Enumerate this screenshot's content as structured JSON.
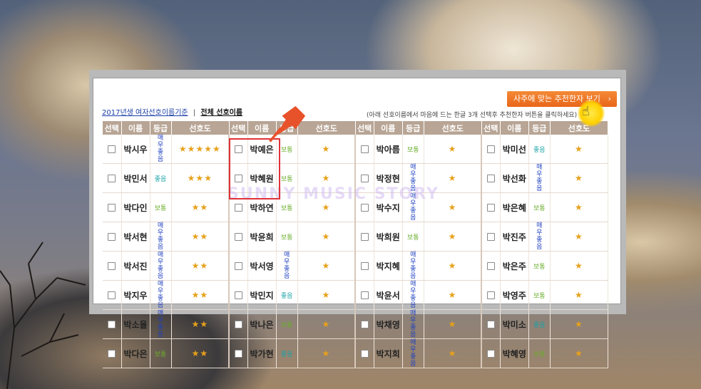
{
  "header": {
    "link_2017": "2017년생 여자선호이름기준",
    "separator": "|",
    "link_all": "전체 선호이름",
    "note": "(아래 선호이름에서 마음에 드는 한글 3개 선택후 추천한자 버튼을 클릭하세요)",
    "recommend_button": "사주에 맞는 추천한자 보기",
    "recommend_arrow": "›"
  },
  "watermark": "SUNNY MUSIC STORY",
  "table": {
    "headers": [
      "선택",
      "이름",
      "등급",
      "선호도"
    ],
    "columns": [
      {
        "rows": [
          {
            "name": "박시우",
            "grade": "매우좋음",
            "grade_type": "veryhigh",
            "stars": 5
          },
          {
            "name": "박민서",
            "grade": "좋음",
            "grade_type": "good",
            "stars": 3
          },
          {
            "name": "박다인",
            "grade": "보통",
            "grade_type": "normal",
            "stars": 2
          },
          {
            "name": "박서현",
            "grade": "매우좋음",
            "grade_type": "veryhigh",
            "stars": 2
          },
          {
            "name": "박서진",
            "grade": "매우좋음",
            "grade_type": "veryhigh",
            "stars": 2
          },
          {
            "name": "박지우",
            "grade": "매우좋음",
            "grade_type": "veryhigh",
            "stars": 2
          },
          {
            "name": "박소율",
            "grade": "매우좋음",
            "grade_type": "veryhigh",
            "stars": 2
          },
          {
            "name": "박다은",
            "grade": "보통",
            "grade_type": "normal",
            "stars": 2
          }
        ]
      },
      {
        "rows": [
          {
            "name": "박예은",
            "grade": "보통",
            "grade_type": "normal",
            "stars": 1
          },
          {
            "name": "박혜원",
            "grade": "보통",
            "grade_type": "normal",
            "stars": 1
          },
          {
            "name": "박하연",
            "grade": "보통",
            "grade_type": "normal",
            "stars": 1
          },
          {
            "name": "박윤희",
            "grade": "보통",
            "grade_type": "normal",
            "stars": 1
          },
          {
            "name": "박서영",
            "grade": "매우좋음",
            "grade_type": "veryhigh",
            "stars": 1
          },
          {
            "name": "박민지",
            "grade": "좋음",
            "grade_type": "good",
            "stars": 1
          },
          {
            "name": "박나은",
            "grade": "보통",
            "grade_type": "normal",
            "stars": 1
          },
          {
            "name": "박가현",
            "grade": "좋음",
            "grade_type": "good",
            "stars": 1
          }
        ]
      },
      {
        "rows": [
          {
            "name": "박아름",
            "grade": "보통",
            "grade_type": "normal",
            "stars": 1
          },
          {
            "name": "박정현",
            "grade": "매우좋음",
            "grade_type": "veryhigh",
            "stars": 1
          },
          {
            "name": "박수지",
            "grade": "매우좋음",
            "grade_type": "veryhigh",
            "stars": 1
          },
          {
            "name": "박희원",
            "grade": "보통",
            "grade_type": "normal",
            "stars": 1
          },
          {
            "name": "박지혜",
            "grade": "매우좋음",
            "grade_type": "veryhigh",
            "stars": 1
          },
          {
            "name": "박윤서",
            "grade": "매우좋음",
            "grade_type": "veryhigh",
            "stars": 1
          },
          {
            "name": "박채영",
            "grade": "매우좋음",
            "grade_type": "veryhigh",
            "stars": 1
          },
          {
            "name": "박지희",
            "grade": "매우좋음",
            "grade_type": "veryhigh",
            "stars": 1
          }
        ]
      },
      {
        "rows": [
          {
            "name": "박미선",
            "grade": "좋음",
            "grade_type": "good",
            "stars": 1
          },
          {
            "name": "박선화",
            "grade": "매우좋음",
            "grade_type": "veryhigh",
            "stars": 1
          },
          {
            "name": "박은혜",
            "grade": "보통",
            "grade_type": "normal",
            "stars": 1
          },
          {
            "name": "박진주",
            "grade": "매우좋음",
            "grade_type": "veryhigh",
            "stars": 1
          },
          {
            "name": "박은주",
            "grade": "보통",
            "grade_type": "normal",
            "stars": 1
          },
          {
            "name": "박영주",
            "grade": "보통",
            "grade_type": "normal",
            "stars": 1
          },
          {
            "name": "박미소",
            "grade": "좋음",
            "grade_type": "good",
            "stars": 1
          },
          {
            "name": "박혜영",
            "grade": "보통",
            "grade_type": "normal",
            "stars": 1
          }
        ]
      }
    ]
  },
  "colors": {
    "header_bg": "#b8a595",
    "button_orange": "#ee741f",
    "grade_veryhigh": "#1d3fbf",
    "grade_good": "#18a2a6",
    "grade_normal": "#6aad2a",
    "star": "#e8a11b",
    "highlight_red": "#e0323a"
  }
}
